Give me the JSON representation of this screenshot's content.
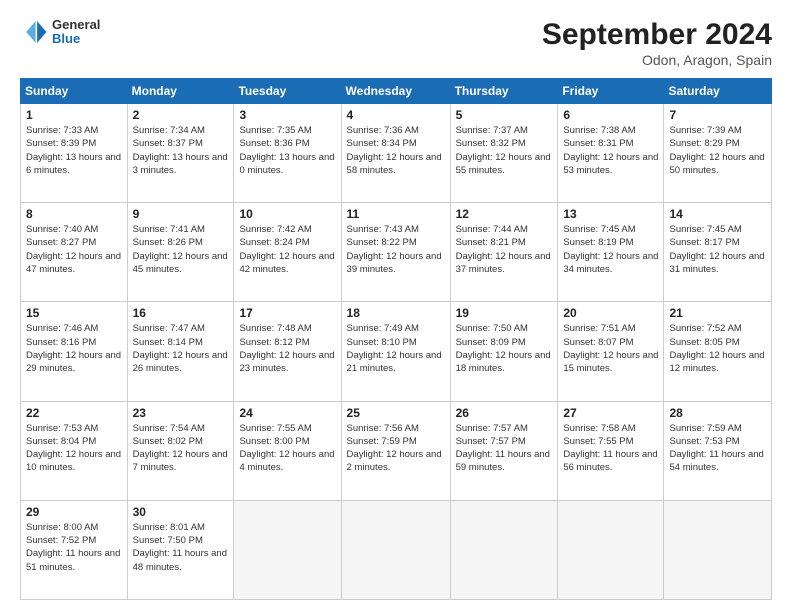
{
  "logo": {
    "general": "General",
    "blue": "Blue"
  },
  "title": {
    "month_year": "September 2024",
    "location": "Odon, Aragon, Spain"
  },
  "weekdays": [
    "Sunday",
    "Monday",
    "Tuesday",
    "Wednesday",
    "Thursday",
    "Friday",
    "Saturday"
  ],
  "weeks": [
    [
      {
        "day": "1",
        "sunrise": "7:33 AM",
        "sunset": "8:39 PM",
        "daylight": "13 hours and 6 minutes."
      },
      {
        "day": "2",
        "sunrise": "7:34 AM",
        "sunset": "8:37 PM",
        "daylight": "13 hours and 3 minutes."
      },
      {
        "day": "3",
        "sunrise": "7:35 AM",
        "sunset": "8:36 PM",
        "daylight": "13 hours and 0 minutes."
      },
      {
        "day": "4",
        "sunrise": "7:36 AM",
        "sunset": "8:34 PM",
        "daylight": "12 hours and 58 minutes."
      },
      {
        "day": "5",
        "sunrise": "7:37 AM",
        "sunset": "8:32 PM",
        "daylight": "12 hours and 55 minutes."
      },
      {
        "day": "6",
        "sunrise": "7:38 AM",
        "sunset": "8:31 PM",
        "daylight": "12 hours and 53 minutes."
      },
      {
        "day": "7",
        "sunrise": "7:39 AM",
        "sunset": "8:29 PM",
        "daylight": "12 hours and 50 minutes."
      }
    ],
    [
      {
        "day": "8",
        "sunrise": "7:40 AM",
        "sunset": "8:27 PM",
        "daylight": "12 hours and 47 minutes."
      },
      {
        "day": "9",
        "sunrise": "7:41 AM",
        "sunset": "8:26 PM",
        "daylight": "12 hours and 45 minutes."
      },
      {
        "day": "10",
        "sunrise": "7:42 AM",
        "sunset": "8:24 PM",
        "daylight": "12 hours and 42 minutes."
      },
      {
        "day": "11",
        "sunrise": "7:43 AM",
        "sunset": "8:22 PM",
        "daylight": "12 hours and 39 minutes."
      },
      {
        "day": "12",
        "sunrise": "7:44 AM",
        "sunset": "8:21 PM",
        "daylight": "12 hours and 37 minutes."
      },
      {
        "day": "13",
        "sunrise": "7:45 AM",
        "sunset": "8:19 PM",
        "daylight": "12 hours and 34 minutes."
      },
      {
        "day": "14",
        "sunrise": "7:45 AM",
        "sunset": "8:17 PM",
        "daylight": "12 hours and 31 minutes."
      }
    ],
    [
      {
        "day": "15",
        "sunrise": "7:46 AM",
        "sunset": "8:16 PM",
        "daylight": "12 hours and 29 minutes."
      },
      {
        "day": "16",
        "sunrise": "7:47 AM",
        "sunset": "8:14 PM",
        "daylight": "12 hours and 26 minutes."
      },
      {
        "day": "17",
        "sunrise": "7:48 AM",
        "sunset": "8:12 PM",
        "daylight": "12 hours and 23 minutes."
      },
      {
        "day": "18",
        "sunrise": "7:49 AM",
        "sunset": "8:10 PM",
        "daylight": "12 hours and 21 minutes."
      },
      {
        "day": "19",
        "sunrise": "7:50 AM",
        "sunset": "8:09 PM",
        "daylight": "12 hours and 18 minutes."
      },
      {
        "day": "20",
        "sunrise": "7:51 AM",
        "sunset": "8:07 PM",
        "daylight": "12 hours and 15 minutes."
      },
      {
        "day": "21",
        "sunrise": "7:52 AM",
        "sunset": "8:05 PM",
        "daylight": "12 hours and 12 minutes."
      }
    ],
    [
      {
        "day": "22",
        "sunrise": "7:53 AM",
        "sunset": "8:04 PM",
        "daylight": "12 hours and 10 minutes."
      },
      {
        "day": "23",
        "sunrise": "7:54 AM",
        "sunset": "8:02 PM",
        "daylight": "12 hours and 7 minutes."
      },
      {
        "day": "24",
        "sunrise": "7:55 AM",
        "sunset": "8:00 PM",
        "daylight": "12 hours and 4 minutes."
      },
      {
        "day": "25",
        "sunrise": "7:56 AM",
        "sunset": "7:59 PM",
        "daylight": "12 hours and 2 minutes."
      },
      {
        "day": "26",
        "sunrise": "7:57 AM",
        "sunset": "7:57 PM",
        "daylight": "11 hours and 59 minutes."
      },
      {
        "day": "27",
        "sunrise": "7:58 AM",
        "sunset": "7:55 PM",
        "daylight": "11 hours and 56 minutes."
      },
      {
        "day": "28",
        "sunrise": "7:59 AM",
        "sunset": "7:53 PM",
        "daylight": "11 hours and 54 minutes."
      }
    ],
    [
      {
        "day": "29",
        "sunrise": "8:00 AM",
        "sunset": "7:52 PM",
        "daylight": "11 hours and 51 minutes."
      },
      {
        "day": "30",
        "sunrise": "8:01 AM",
        "sunset": "7:50 PM",
        "daylight": "11 hours and 48 minutes."
      },
      null,
      null,
      null,
      null,
      null
    ]
  ]
}
